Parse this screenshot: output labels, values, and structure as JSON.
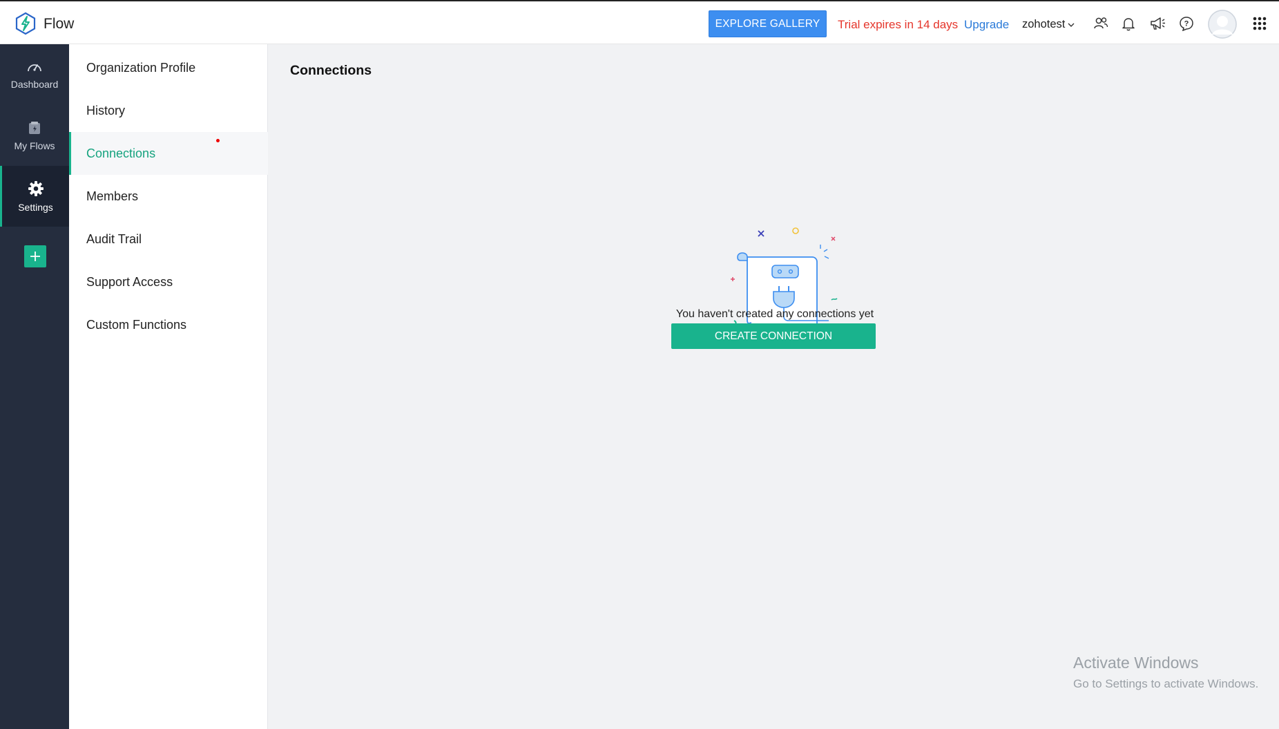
{
  "header": {
    "app_title": "Flow",
    "explore_label": "EXPLORE GALLERY",
    "trial_text": "Trial expires in 14 days",
    "upgrade_label": "Upgrade",
    "org_name": "zohotest",
    "icons": [
      "people-icon",
      "bell-icon",
      "megaphone-icon",
      "help-icon",
      "avatar",
      "apps-grid-icon"
    ]
  },
  "leftnav": {
    "items": [
      {
        "label": "Dashboard",
        "icon": "gauge-icon"
      },
      {
        "label": "My Flows",
        "icon": "flows-icon"
      },
      {
        "label": "Settings",
        "icon": "gear-icon",
        "active": true
      }
    ],
    "add_icon": "plus-icon"
  },
  "settings_menu": {
    "items": [
      {
        "label": "Organization Profile"
      },
      {
        "label": "History"
      },
      {
        "label": "Connections",
        "active": true
      },
      {
        "label": "Members"
      },
      {
        "label": "Audit Trail"
      },
      {
        "label": "Support Access"
      },
      {
        "label": "Custom Functions"
      }
    ]
  },
  "main": {
    "title": "Connections",
    "empty_message": "You haven't created any connections yet",
    "create_label": "CREATE CONNECTION"
  },
  "watermark": {
    "title": "Activate Windows",
    "subtitle": "Go to Settings to activate Windows."
  },
  "colors": {
    "accent": "#19b38d",
    "primary_blue": "#3d8ef0",
    "trial_red": "#e5352b",
    "nav_bg": "#252d3e"
  }
}
